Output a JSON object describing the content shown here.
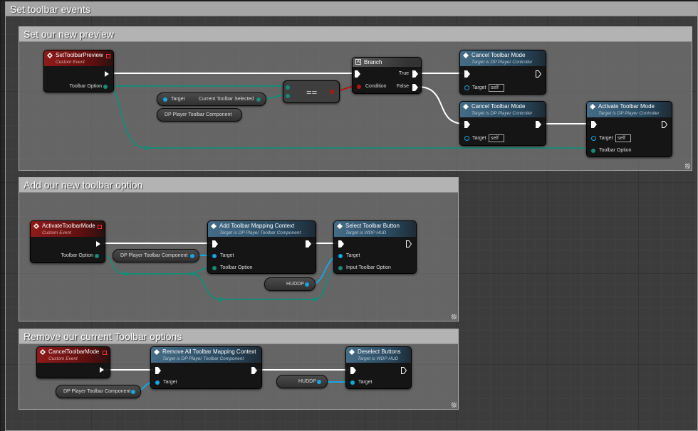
{
  "colors": {
    "exec": "#ffffff",
    "object": "#16a7e0",
    "enum": "#1a8a78",
    "bool": "#b01515",
    "event_header": "#8f1b1b",
    "function_header": "#456c87"
  },
  "comments": {
    "outer": "Set toolbar events",
    "preview": "Set our new preview",
    "add": "Add our new toolbar option",
    "remove": "Remove our current Toolbar options"
  },
  "labels": {
    "custom_event": "Custom Event",
    "toolbar_option": "Toolbar Option",
    "target": "Target",
    "self": "self",
    "true": "True",
    "false": "False",
    "condition": "Condition",
    "equals": "==",
    "input_toolbar_option": "Input Toolbar Option"
  },
  "nodes": {
    "set_toolbar_preview": "SetToolbarPreview",
    "branch": "Branch",
    "cancel_mode_1": {
      "title": "Cancel Toolbar Mode",
      "sub": "Target is DP Player Controller"
    },
    "cancel_mode_2": {
      "title": "Cancel Toolbar Mode",
      "sub": "Target is DP Player Controller"
    },
    "activate_mode": {
      "title": "Activate Toolbar Mode",
      "sub": "Target is DP Player Controller"
    },
    "current_selected": {
      "target": "Target",
      "output": "Current Toolbar Selected"
    },
    "dp_player_toolbar_component": "DP Player Toolbar Component",
    "activate_toolbar_mode_event": "ActivateToolbarMode",
    "add_mapping": {
      "title": "Add Toolbar Mapping Context",
      "sub": "Target is DP Player Toolbar Component"
    },
    "select_button": {
      "title": "Select Toolbar Button",
      "sub": "Target is WDP HUD"
    },
    "hud": "HUDDP",
    "cancel_toolbar_mode_event": "CancelToolbarMode",
    "remove_all": {
      "title": "Remove All Toolbar Mapping Context",
      "sub": "Target is DP Player Toolbar Component"
    },
    "deselect": {
      "title": "Deselect Buttons",
      "sub": "Target is WDP HUD"
    }
  }
}
